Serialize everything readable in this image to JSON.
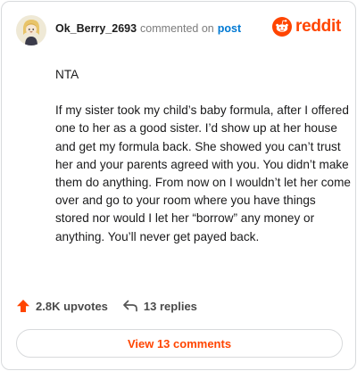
{
  "comment": {
    "username": "Ok_Berry_2693",
    "commented_on_text": "commented on",
    "post_link_text": "post",
    "brand": "reddit",
    "body": {
      "line1": "NTA",
      "paragraph": "If my sister took my child’s baby formula, after I offered one to her as a good sister. I’d show up at her house and get my formula back. She showed you can’t trust her and your parents agreed with you. You didn’t make them do anything. From now on I wouldn’t let her come over and go to your room where you have things stored nor would I let her “borrow” any money or anything. You’ll never get payed back."
    }
  },
  "actions": {
    "upvotes_label": "2.8K upvotes",
    "replies_label": "13 replies"
  },
  "footer": {
    "view_comments_label": "View 13 comments"
  },
  "colors": {
    "brand_orange": "#ff4500",
    "link_blue": "#0079d3"
  },
  "icons": {
    "avatar": "user-avatar-icon",
    "brand": "reddit-logo-icon",
    "upvote": "upvote-arrow-icon",
    "reply": "reply-arrow-icon"
  }
}
